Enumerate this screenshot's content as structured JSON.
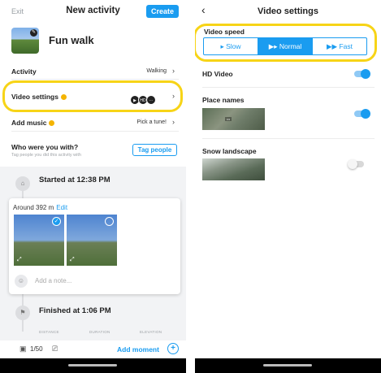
{
  "left": {
    "header": {
      "exit": "Exit",
      "title": "New activity",
      "create": "Create"
    },
    "activity_name": "Fun walk",
    "rows": {
      "activity": {
        "label": "Activity",
        "value": "Walking"
      },
      "video_settings": {
        "label": "Video settings",
        "badges": [
          "▶",
          "HD",
          "···"
        ]
      },
      "add_music": {
        "label": "Add music",
        "value": "Pick a tune!"
      }
    },
    "who": {
      "label": "Who were you with?",
      "sub": "Tag people you did this activity with",
      "button": "Tag people"
    },
    "timeline": {
      "start": "Started at 12:38 PM",
      "around": "Around 392 m",
      "edit": "Edit",
      "note_placeholder": "Add a note...",
      "finish": "Finished at 1:06 PM",
      "stats": [
        "DISTANCE",
        "DURATION",
        "ELEVATION"
      ]
    },
    "bottom": {
      "count": "1/50",
      "add_moment": "Add moment"
    }
  },
  "right": {
    "header": {
      "title": "Video settings"
    },
    "video_speed": {
      "label": "Video speed",
      "options": [
        "Slow",
        "Normal",
        "Fast"
      ],
      "selected": "Normal"
    },
    "hd_video": {
      "label": "HD Video",
      "on": true
    },
    "place_names": {
      "label": "Place names",
      "on": true
    },
    "snow_landscape": {
      "label": "Snow landscape",
      "on": false
    }
  },
  "colors": {
    "accent": "#1a9cf0",
    "highlight": "#f7d417",
    "coin": "#f4b400"
  }
}
